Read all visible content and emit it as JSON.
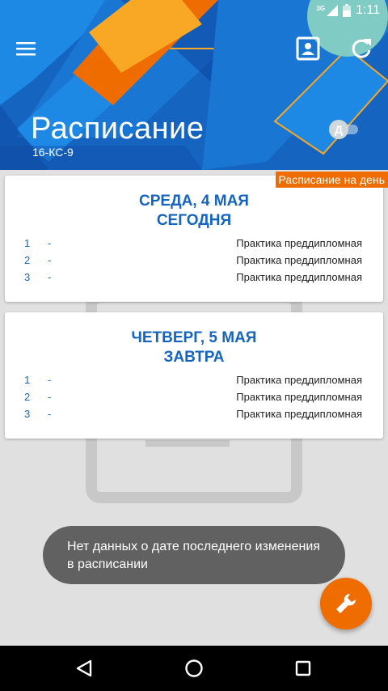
{
  "status": {
    "time": "1:11",
    "network": "3G"
  },
  "header": {
    "title": "Расписание",
    "group": "16-КС-9",
    "toggle_label": "Д",
    "day_tag": "Расписание на день"
  },
  "days": [
    {
      "date": "СРЕДА, 4 МАЯ",
      "relative": "СЕГОДНЯ",
      "lessons": [
        {
          "num": "1",
          "time": "-",
          "name": "Практика преддипломная"
        },
        {
          "num": "2",
          "time": "-",
          "name": "Практика преддипломная"
        },
        {
          "num": "3",
          "time": "-",
          "name": "Практика преддипломная"
        }
      ]
    },
    {
      "date": "ЧЕТВЕРГ, 5 МАЯ",
      "relative": "ЗАВТРА",
      "lessons": [
        {
          "num": "1",
          "time": "-",
          "name": "Практика преддипломная"
        },
        {
          "num": "2",
          "time": "-",
          "name": "Практика преддипломная"
        },
        {
          "num": "3",
          "time": "-",
          "name": "Практика преддипломная"
        }
      ]
    }
  ],
  "toast": "Нет данных о дате последнего изменения в расписании",
  "colors": {
    "primary": "#1565c0",
    "accent": "#ef6c00",
    "toast": "#616161"
  },
  "icons": [
    "menu-icon",
    "contact-icon",
    "refresh-icon",
    "wrench-icon",
    "back-icon",
    "home-icon",
    "recents-icon"
  ]
}
